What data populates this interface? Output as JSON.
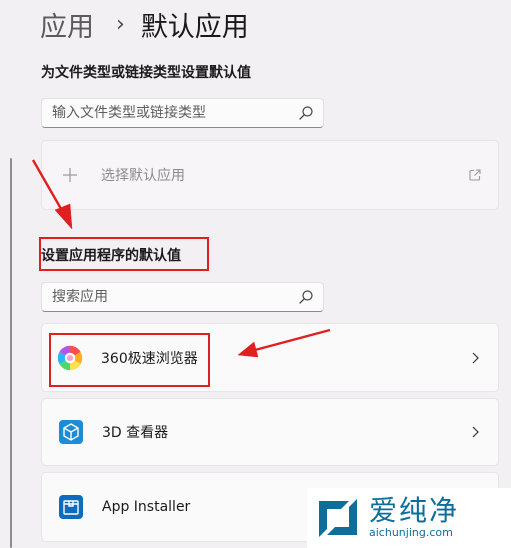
{
  "breadcrumb": {
    "parent": "应用",
    "current": "默认应用"
  },
  "file_types": {
    "heading": "为文件类型或链接类型设置默认值",
    "search_placeholder": "输入文件类型或链接类型",
    "choose_default_label": "选择默认应用"
  },
  "app_defaults": {
    "heading": "设置应用程序的默认值",
    "search_placeholder": "搜索应用",
    "apps": [
      {
        "name": "360极速浏览器",
        "icon": "chrome-like-colorful-icon"
      },
      {
        "name": "3D 查看器",
        "icon": "cube-icon"
      },
      {
        "name": "App Installer",
        "icon": "package-icon"
      }
    ]
  },
  "watermark": {
    "title": "爱纯净",
    "url": "aichunjing.com"
  },
  "colors": {
    "accent": "#0067c0",
    "annotation": "#e02020",
    "watermark": "#0d6e9c"
  }
}
